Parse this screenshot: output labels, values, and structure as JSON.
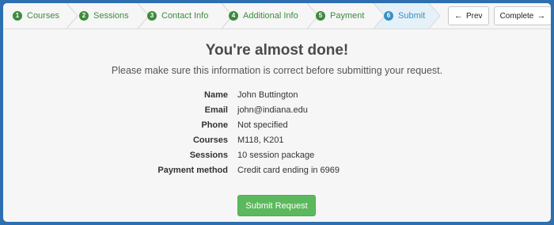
{
  "wizard": {
    "steps": [
      {
        "num": "1",
        "label": "Courses"
      },
      {
        "num": "2",
        "label": "Sessions"
      },
      {
        "num": "3",
        "label": "Contact Info"
      },
      {
        "num": "4",
        "label": "Additional Info"
      },
      {
        "num": "5",
        "label": "Payment"
      },
      {
        "num": "6",
        "label": "Submit"
      }
    ],
    "prev_label": "Prev",
    "complete_label": "Complete"
  },
  "main": {
    "title": "You're almost done!",
    "subtitle": "Please make sure this information is correct before submitting your request.",
    "summary": [
      {
        "key": "Name",
        "value": "John Buttington"
      },
      {
        "key": "Email",
        "value": "john@indiana.edu"
      },
      {
        "key": "Phone",
        "value": "Not specified"
      },
      {
        "key": "Courses",
        "value": "M118, K201"
      },
      {
        "key": "Sessions",
        "value": "10 session package"
      },
      {
        "key": "Payment method",
        "value": "Credit card ending in 6969"
      }
    ],
    "submit_label": "Submit Request"
  },
  "colors": {
    "completed_step": "#3d8b3d",
    "active_step": "#3a8fc4",
    "submit_button": "#5cb85c",
    "window_border": "#2d6fb0"
  },
  "icons": {
    "prev": "arrow-left-icon",
    "complete": "arrow-right-icon"
  }
}
